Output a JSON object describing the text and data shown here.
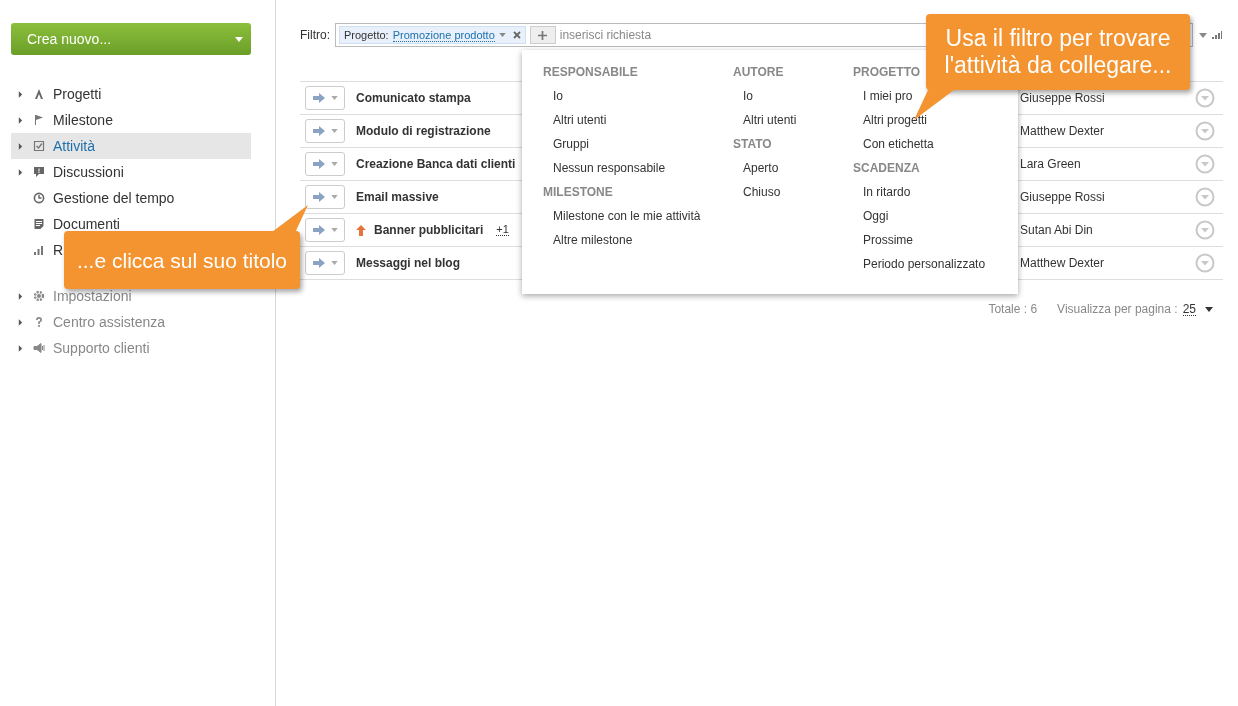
{
  "sidebar": {
    "create_button": "Crea nuovo...",
    "items": [
      {
        "label": "Progetti",
        "expandable": true,
        "selected": false,
        "muted": false
      },
      {
        "label": "Milestone",
        "expandable": true,
        "selected": false,
        "muted": false
      },
      {
        "label": "Attività",
        "expandable": true,
        "selected": true,
        "muted": false
      },
      {
        "label": "Discussioni",
        "expandable": true,
        "selected": false,
        "muted": false
      },
      {
        "label": "Gestione del tempo",
        "expandable": false,
        "selected": false,
        "muted": false
      },
      {
        "label": "Documenti",
        "expandable": false,
        "selected": false,
        "muted": false
      },
      {
        "label": "R",
        "expandable": false,
        "selected": false,
        "muted": false
      }
    ],
    "footer_items": [
      {
        "label": "Impostazioni",
        "expandable": true,
        "selected": false,
        "muted": true
      },
      {
        "label": "Centro assistenza",
        "expandable": true,
        "selected": false,
        "muted": true
      },
      {
        "label": "Supporto clienti",
        "expandable": true,
        "selected": false,
        "muted": true
      }
    ]
  },
  "filter": {
    "label": "Filtro:",
    "tag_key": "Progetto:",
    "tag_value": "Promozione prodotto",
    "placeholder": "inserisci richiesta"
  },
  "tasks": [
    {
      "title": "Comunicato stampa",
      "priority": false,
      "responsible": "Giuseppe Rossi"
    },
    {
      "title": "Modulo di registrazione",
      "priority": false,
      "responsible": "Matthew Dexter"
    },
    {
      "title": "Creazione Banca dati clienti",
      "priority": false,
      "responsible": "Lara Green"
    },
    {
      "title": "Email massive",
      "priority": false,
      "responsible": "Giuseppe Rossi"
    },
    {
      "title": "Banner pubblicitari",
      "priority": true,
      "extra": "+1",
      "responsible": "Sutan Abi Din"
    },
    {
      "title": "Messaggi nel blog",
      "priority": false,
      "responsible": "Matthew Dexter"
    }
  ],
  "pager": {
    "total": "Totale : 6",
    "per_page_label": "Visualizza per pagina :",
    "per_page": "25"
  },
  "filter_menu": {
    "columns": [
      [
        {
          "heading": "RESPONSABILE",
          "options": [
            "Io",
            "Altri utenti",
            "Gruppi",
            "Nessun responsabile"
          ]
        },
        {
          "heading": "MILESTONE",
          "options": [
            "Milestone con le mie attività",
            "Altre milestone"
          ]
        }
      ],
      [
        {
          "heading": "AUTORE",
          "options": [
            "Io",
            "Altri utenti"
          ]
        },
        {
          "heading": "STATO",
          "options": [
            "Aperto",
            "Chiuso"
          ]
        }
      ],
      [
        {
          "heading": "PROGETTO",
          "options": [
            "I miei pro",
            "Altri progetti",
            "Con etichetta"
          ]
        },
        {
          "heading": "SCADENZA",
          "options": [
            "In ritardo",
            "Oggi",
            "Prossime",
            "Periodo personalizzato"
          ]
        }
      ]
    ]
  },
  "callouts": [
    {
      "text": "Usa il filtro per trovare l'attività da collegare..."
    },
    {
      "text": "...e clicca sul suo titolo"
    }
  ]
}
